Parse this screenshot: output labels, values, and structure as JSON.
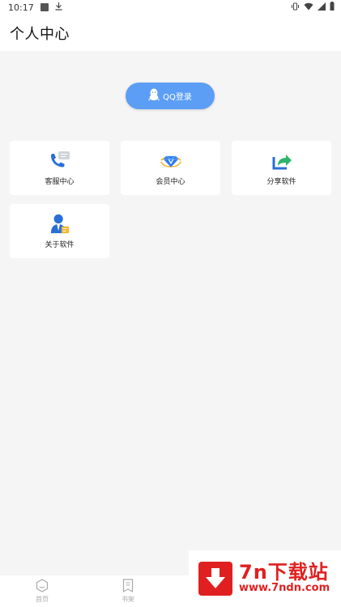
{
  "status_bar": {
    "time": "10:17"
  },
  "header": {
    "title": "个人中心"
  },
  "login": {
    "label": "QQ登录"
  },
  "cards": [
    {
      "label": "客服中心",
      "icon": "phone-chat-icon"
    },
    {
      "label": "会员中心",
      "icon": "vip-diamond-icon"
    },
    {
      "label": "分享软件",
      "icon": "share-icon"
    },
    {
      "label": "关于软件",
      "icon": "user-info-icon"
    }
  ],
  "nav": [
    {
      "label": "首页",
      "icon": "home-hexagon-icon"
    },
    {
      "label": "书架",
      "icon": "bookmark-icon"
    }
  ],
  "watermark": {
    "main": "7n下载站",
    "sub": "www.7ndn.com"
  },
  "colors": {
    "accent": "#5c9ef6",
    "watermark": "#e02020"
  }
}
